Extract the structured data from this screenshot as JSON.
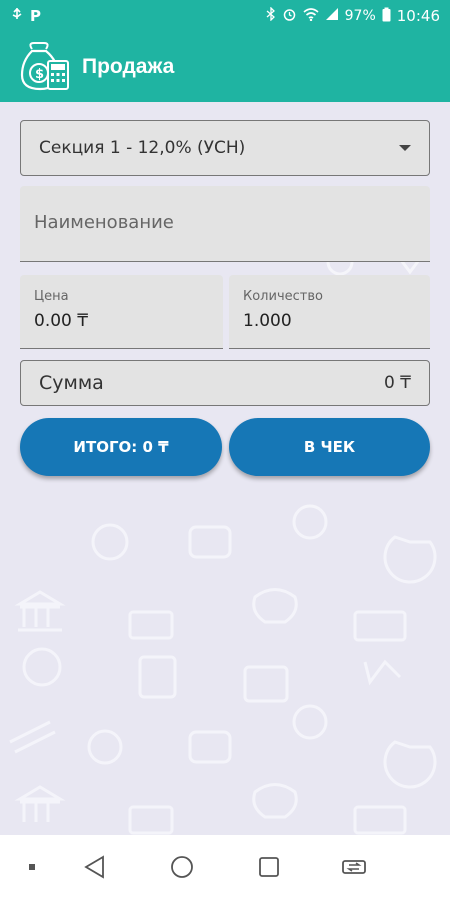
{
  "status_bar": {
    "time": "10:46",
    "battery": "97%",
    "left_icons": [
      "usb-icon",
      "p-icon"
    ],
    "right_icons": [
      "bluetooth-icon",
      "alarm-icon",
      "wifi-icon",
      "signal-icon",
      "battery-icon"
    ]
  },
  "app_bar": {
    "title": "Продажа",
    "color": "#1fb4a2"
  },
  "form": {
    "section_select": "Секция 1 - 12,0% (УСН)",
    "name_placeholder": "Наименование",
    "price_label": "Цена",
    "price_value": "0.00 ₸",
    "qty_label": "Количество",
    "qty_value": "1.000",
    "sum_label": "Сумма",
    "sum_value": "0 ₸"
  },
  "buttons": {
    "total_label": "ИТОГО: 0 ₸",
    "to_check_label": "В ЧЕК",
    "color": "#1677b6"
  },
  "nav_bar": {
    "items": [
      "dot-icon",
      "back-icon",
      "home-icon",
      "recents-icon",
      "switch-app-icon"
    ]
  }
}
